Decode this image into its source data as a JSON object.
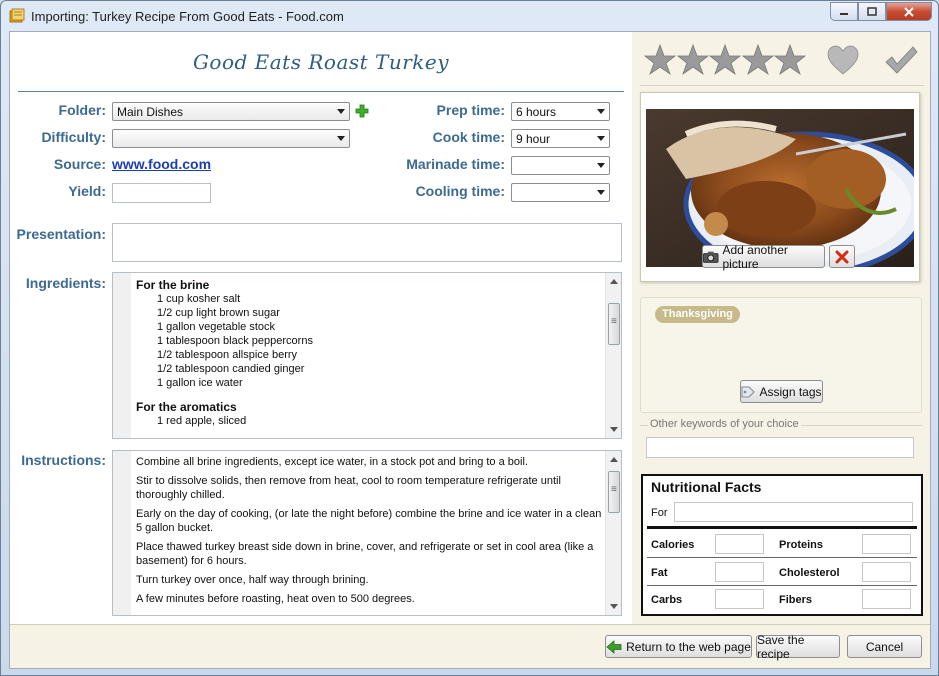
{
  "window": {
    "title": "Importing: Turkey Recipe From Good Eats - Food.com"
  },
  "recipe": {
    "title": "Good Eats Roast Turkey"
  },
  "fields": {
    "folder_label": "Folder:",
    "folder_value": "Main Dishes",
    "difficulty_label": "Difficulty:",
    "difficulty_value": "",
    "source_label": "Source:",
    "source_value": "www.food.com",
    "yield_label": "Yield:",
    "yield_value": "",
    "prep_label": "Prep time:",
    "prep_value": "6 hours",
    "cook_label": "Cook time:",
    "cook_value": "9 hour",
    "marinade_label": "Marinade time:",
    "marinade_value": "",
    "cooling_label": "Cooling time:",
    "cooling_value": "",
    "presentation_label": "Presentation:",
    "ingredients_label": "Ingredients:",
    "instructions_label": "Instructions:"
  },
  "ingredients": {
    "brine_heading": "For the brine",
    "brine_items": [
      "1 cup kosher salt",
      "1/2 cup light brown sugar",
      "1 gallon vegetable stock",
      "1 tablespoon black peppercorns",
      "1/2 tablespoon allspice berry",
      "1/2 tablespoon candied ginger",
      "1 gallon ice water"
    ],
    "aromatics_heading": "For the aromatics",
    "aromatics_items": [
      "1 red apple, sliced"
    ]
  },
  "instructions": [
    "Combine all brine ingredients, except ice water, in a stock pot and bring to a boil.",
    "Stir to dissolve solids, then remove from heat, cool to room temperature refrigerate until thoroughly chilled.",
    "Early on the day of cooking, (or late the night before) combine the brine and ice water in a clean 5 gallon bucket.",
    "Place thawed turkey breast side down in brine, cover, and refrigerate or set in cool area (like a basement) for 6 hours.",
    "Turn turkey over once, half way through brining.",
    "A few minutes before roasting, heat oven to 500 degrees."
  ],
  "rating": {
    "stars": 0,
    "max_stars": 5,
    "icons": [
      "star-icon",
      "heart-icon",
      "checkmark-icon"
    ]
  },
  "picture": {
    "add_label": "Add another picture"
  },
  "tags": {
    "items": [
      "Thanksgiving"
    ],
    "assign_label": "Assign tags"
  },
  "keywords": {
    "label": "Other keywords of your choice",
    "value": ""
  },
  "nutrition": {
    "title": "Nutritional Facts",
    "for_label": "For",
    "calories": "Calories",
    "proteins": "Proteins",
    "fat": "Fat",
    "cholesterol": "Cholesterol",
    "carbs": "Carbs",
    "fibers": "Fibers"
  },
  "buttons": {
    "return": "Return to the web page",
    "save": "Save the recipe",
    "cancel": "Cancel"
  },
  "colors": {
    "label_blue": "#3d6a90",
    "title_blue": "#2e5e80",
    "tag_chip": "#c7b98a",
    "panel_bg": "#f6f2e6"
  }
}
